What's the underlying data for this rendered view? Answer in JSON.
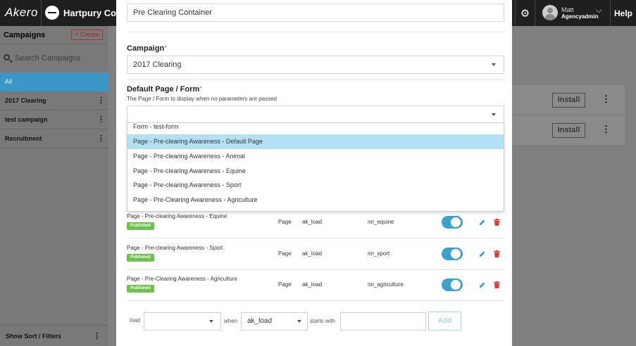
{
  "topbar": {
    "logo": "Akero",
    "college": "Hartpury College",
    "user_name": "Matt",
    "user_role": "Agencyadmin",
    "help": "Help"
  },
  "sidebar": {
    "title": "Campaigns",
    "create_label": "+ Create",
    "search_placeholder": "Search Campaigns",
    "items": [
      {
        "label": "All",
        "active": true
      },
      {
        "label": "2017 Clearing"
      },
      {
        "label": "test campaign"
      },
      {
        "label": "Recruitment"
      }
    ],
    "footer": "Show Sort / Filters"
  },
  "background": {
    "install_label": "Install"
  },
  "modal": {
    "name_value": "Pre Clearing Container",
    "campaign_label": "Campaign",
    "campaign_value": "2017 Clearing",
    "default_label": "Default Page / Form",
    "default_help": "The Page / Form to display when no parameters are passed",
    "dropdown_options": [
      "Form - test-form",
      "Page - Pre-clearing Awareness - Default Page",
      "Page - Pre-clearing Awareness - Animal",
      "Page - Pre-clearing Awareness - Equine",
      "Page - Pre-clearing Awareness - Sport",
      "Page - Pre-Clearing Awareness - Agriculture"
    ],
    "highlighted_option_index": 1,
    "rows": [
      {
        "title": "Page - Pre-clearing Awareness - Equine",
        "badge": "Published",
        "type": "Page",
        "param": "ak_load",
        "value": "nn_equine",
        "enabled": true
      },
      {
        "title": "Page - Pre-clearing Awareness - Sport",
        "badge": "Published",
        "type": "Page",
        "param": "ak_load",
        "value": "nn_sport",
        "enabled": true
      },
      {
        "title": "Page - Pre-Clearing Awareness - Agriculture",
        "badge": "Published",
        "type": "Page",
        "param": "ak_load",
        "value": "nn_agriculture",
        "enabled": true
      }
    ],
    "filter": {
      "load_label": "load",
      "when_label": "when",
      "param_value": "ak_load",
      "starts_label": "starts with",
      "add_label": "Add"
    }
  },
  "colors": {
    "accent": "#3ba0d2",
    "published": "#6cc24a",
    "required": "#e03b3b",
    "highlight": "#b4e0f4"
  }
}
